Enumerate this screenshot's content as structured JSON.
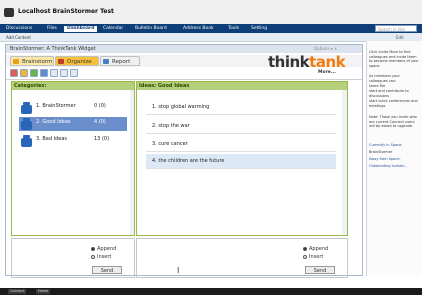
{
  "app": {
    "title": "Localhost BrainStormer Test"
  },
  "nav": {
    "tabs": [
      {
        "label": "Discussions"
      },
      {
        "label": "Files"
      },
      {
        "label": "Dashboard"
      },
      {
        "label": "Calendar"
      },
      {
        "label": "Bulletin Board"
      },
      {
        "label": "Address Book"
      },
      {
        "label": "Tools"
      },
      {
        "label": "Setting"
      }
    ],
    "active": "Dashboard",
    "search_placeholder": "Search in this space"
  },
  "subbar": {
    "add_content": "Add Content",
    "edit": "Edit"
  },
  "widget": {
    "title": "BrainStormer: A ThinkTank Widget",
    "controls": "Options ▾ ×",
    "tabs": [
      {
        "label": "Brainstorm"
      },
      {
        "label": "Organize"
      },
      {
        "label": "Report"
      }
    ],
    "active_tab": "Organize",
    "logo_think": "think",
    "logo_tank": "tank",
    "more_label": "More..."
  },
  "categories": {
    "header": "Categories:",
    "items": [
      {
        "label": "1. BrainStormer",
        "count": "0 (0)"
      },
      {
        "label": "2. Good Ideas",
        "count": "4 (0)"
      },
      {
        "label": "3. Bad Ideas",
        "count": "13 (0)"
      }
    ],
    "selected_index": 1
  },
  "ideas": {
    "header": "Ideas: Good Ideas",
    "items": [
      {
        "text": "1. stop global warming"
      },
      {
        "text": "2. stop the war"
      },
      {
        "text": "3. cure cancer"
      },
      {
        "text": "4. the children are the future"
      }
    ],
    "selected_index": 3
  },
  "input_left": {
    "append_label": "Append",
    "insert_label": "Insert",
    "send_label": "Send"
  },
  "input_right": {
    "append_label": "Append",
    "insert_label": "Insert",
    "send_label": "Send"
  },
  "sidebar": {
    "lines": [
      "Click Invite More to find colleagues and invite them to become members of your space.",
      "As members your colleagues can:",
      "share file",
      "start and contribute to discussions",
      "start voice conferences and meetings",
      "Note: Those you invite who are current Connect users will be asked to upgrade.",
      "Currently in Space:",
      "BrainStormer",
      "Away from Space:",
      "Outstanding Invitati..."
    ]
  },
  "taskbar": {
    "items": [
      "Connect",
      "Home"
    ]
  },
  "colors": {
    "nav_bg": "#0e3f79",
    "panel_header": "#b4d07a",
    "accent_orange": "#f07c12",
    "selected_blue": "#6a8ecb"
  }
}
